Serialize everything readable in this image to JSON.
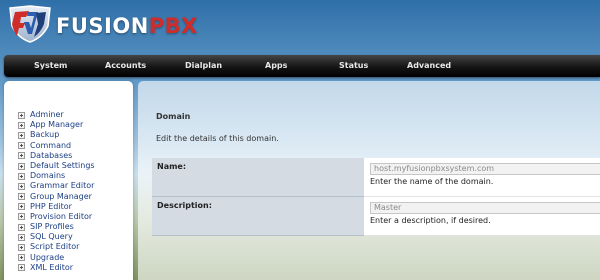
{
  "brand": {
    "name_part1": "FUSION",
    "name_part2": "PBX"
  },
  "menu": [
    {
      "label": "System"
    },
    {
      "label": "Accounts"
    },
    {
      "label": "Dialplan"
    },
    {
      "label": "Apps"
    },
    {
      "label": "Status"
    },
    {
      "label": "Advanced"
    }
  ],
  "sidebar": {
    "items": [
      {
        "label": "Adminer"
      },
      {
        "label": "App Manager"
      },
      {
        "label": "Backup"
      },
      {
        "label": "Command"
      },
      {
        "label": "Databases"
      },
      {
        "label": "Default Settings"
      },
      {
        "label": "Domains"
      },
      {
        "label": "Grammar Editor"
      },
      {
        "label": "Group Manager"
      },
      {
        "label": "PHP Editor"
      },
      {
        "label": "Provision Editor"
      },
      {
        "label": "SIP Profiles"
      },
      {
        "label": "SQL Query"
      },
      {
        "label": "Script Editor"
      },
      {
        "label": "Upgrade"
      },
      {
        "label": "XML Editor"
      }
    ]
  },
  "main": {
    "title": "Domain",
    "description": "Edit the details of this domain.",
    "fields": {
      "name": {
        "label": "Name:",
        "value": "host.myfusionpbxsystem.com",
        "hint": "Enter the name of the domain."
      },
      "description": {
        "label": "Description:",
        "value": "Master",
        "hint": "Enter a description, if desired."
      }
    }
  },
  "colors": {
    "menubar": "#000000",
    "brand_red": "#cf2d2a",
    "link": "#1c3f84",
    "label_cell": "#d5dbe3"
  }
}
